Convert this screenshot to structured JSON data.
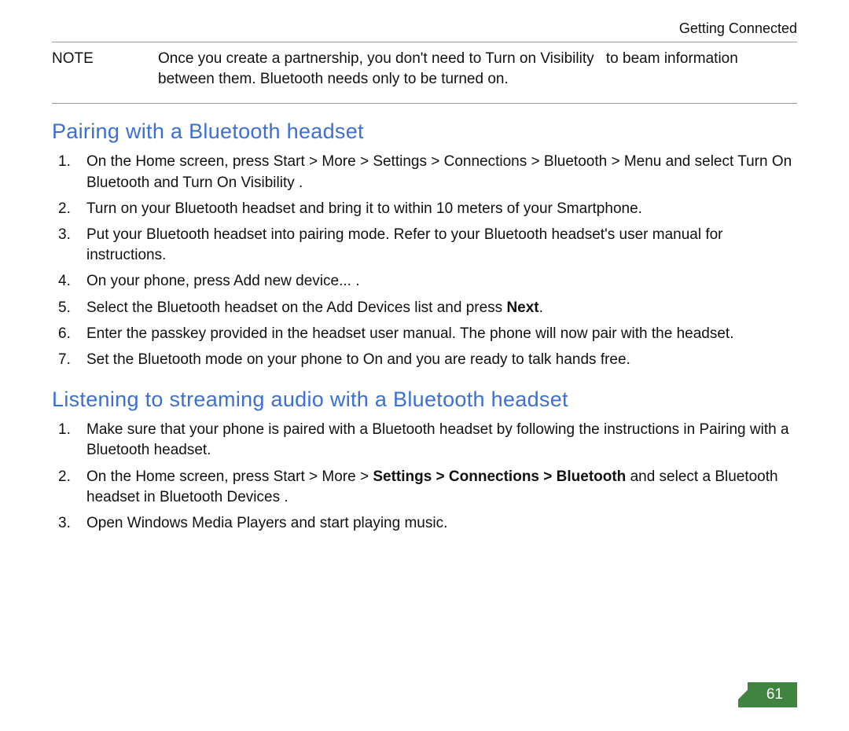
{
  "header": {
    "section_title": "Getting Connected"
  },
  "note": {
    "label": "NOTE",
    "body_a": "Once you create a partnership, you don't need to Turn on Visibility",
    "body_b": "to beam information between them. Bluetooth needs only to be turned on."
  },
  "sections": {
    "pairing": {
      "heading": "Pairing with a   Bluetooth headset",
      "steps": [
        "On the Home screen, press Start   > More > Settings > Connections > Bluetooth > Menu     and select Turn On Bluetooth   and Turn On Visibility  .",
        "Turn on your Bluetooth headset and bring it to within 10 meters of your Smartphone.",
        "Put your Bluetooth headset into pairing mode. Refer to your Bluetooth headset's user manual for instructions.",
        "On your phone, press Add new device...  .",
        {
          "prefix": "Select the Bluetooth headset on the Add Devices list and press ",
          "bold": "Next",
          "suffix": "."
        },
        "Enter the passkey provided in the headset user manual. The phone will now pair with the headset.",
        "Set the Bluetooth mode on your phone to On and you are ready to talk hands free."
      ]
    },
    "streaming": {
      "heading": "Listening to streaming audio with a Bluetooth headset",
      "steps": [
        "Make sure that your phone is paired with a Bluetooth headset by following the instructions in  Pairing with a Bluetooth headset.",
        {
          "prefix": "On the Home screen, press Start   > More > ",
          "bold": "Settings > Connections > Bluetooth",
          "suffix": "     and select a Bluetooth headset in Bluetooth Devices  ."
        },
        "Open Windows Media Players and start playing music."
      ]
    }
  },
  "page_number": "61"
}
